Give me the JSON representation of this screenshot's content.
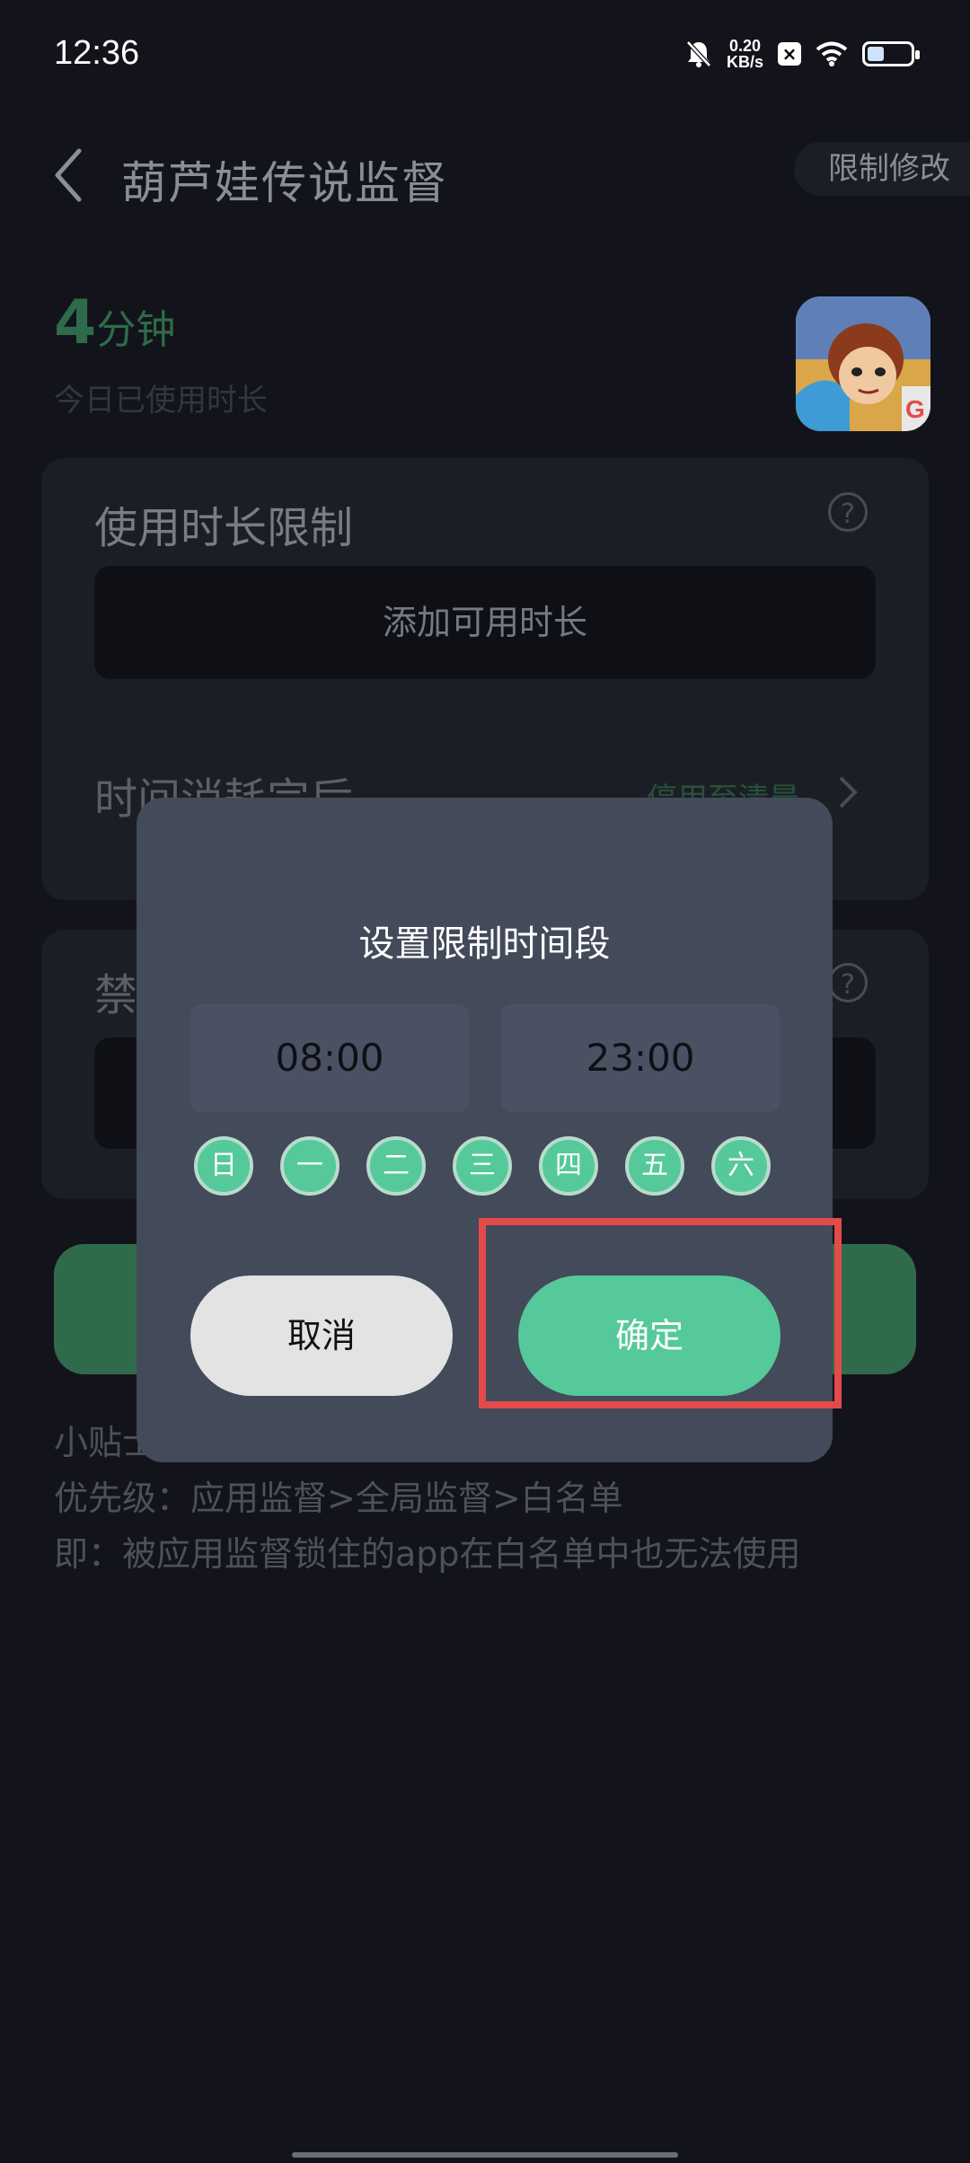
{
  "status_bar": {
    "time": "12:36",
    "net_speed_value": "0.20",
    "net_speed_unit": "KB/s",
    "battery_level": 0.4
  },
  "header": {
    "title": "葫芦娃传说监督",
    "limit_edit": "限制修改"
  },
  "usage": {
    "value": "4",
    "unit": "分钟",
    "label": "今日已使用时长"
  },
  "time_limit_card": {
    "title": "使用时长限制",
    "add_button": "添加可用时长",
    "after_label": "时间消耗完后",
    "after_value": "停用至清晨"
  },
  "forbid_card": {
    "title": "禁"
  },
  "tips": {
    "line1": "小贴士",
    "line2": "优先级：应用监督>全局监督>白名单",
    "line3": "即：被应用监督锁住的app在白名单中也无法使用"
  },
  "dialog": {
    "title": "设置限制时间段",
    "start_time": "08:00",
    "end_time": "23:00",
    "days": [
      "日",
      "一",
      "二",
      "三",
      "四",
      "五",
      "六"
    ],
    "cancel": "取消",
    "confirm": "确定"
  },
  "colors": {
    "accent": "#55c99a",
    "highlight": "#e34b4b",
    "dialog_bg": "#434a5a",
    "page_bg": "#13141b"
  }
}
